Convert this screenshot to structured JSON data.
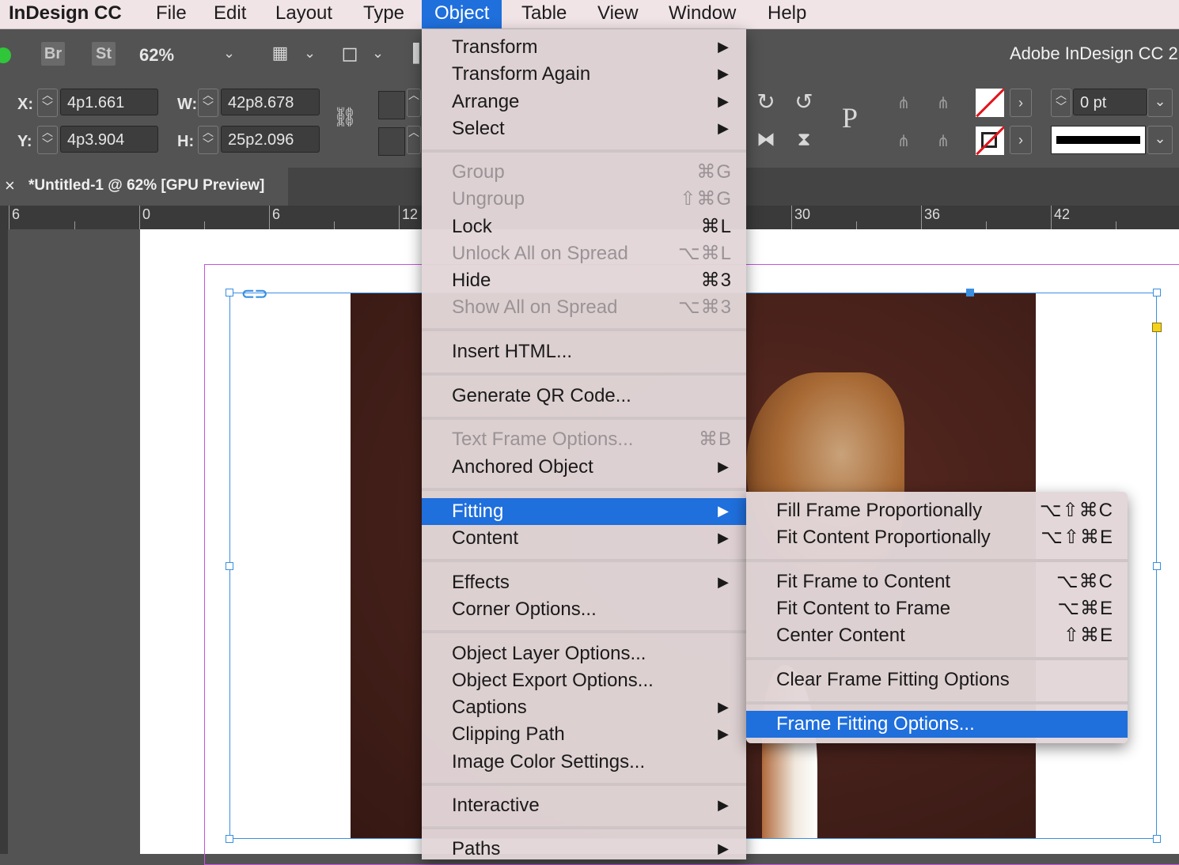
{
  "menubar": {
    "app": "InDesign CC",
    "items": [
      "File",
      "Edit",
      "Layout",
      "Type",
      "Object",
      "Table",
      "View",
      "Window",
      "Help"
    ],
    "active": "Object"
  },
  "control": {
    "bridge": "Br",
    "stock": "St",
    "zoom": "62%",
    "x_label": "X:",
    "x_value": "4p1.661",
    "y_label": "Y:",
    "y_value": "4p3.904",
    "w_label": "W:",
    "w_value": "42p8.678",
    "h_label": "H:",
    "h_value": "25p2.096",
    "stroke_weight": "0 pt",
    "workspace_title": "Adobe InDesign CC 2",
    "icons": [
      "link-constrain-icon",
      "rotate-cw-icon",
      "rotate-ccw-icon",
      "flip-horizontal-icon",
      "flip-vertical-icon",
      "text-frame-icon",
      "align-icon",
      "fill-none-icon",
      "stroke-none-icon",
      "chevron-right-icon",
      "chevron-down-icon"
    ]
  },
  "tab": {
    "close": "×",
    "title": "*Untitled-1 @ 62% [GPU Preview]"
  },
  "ruler": {
    "labels": [
      "6",
      "0",
      "6",
      "12",
      "30",
      "36",
      "42"
    ]
  },
  "object_menu": {
    "items": [
      {
        "label": "Transform",
        "submenu": true
      },
      {
        "label": "Transform Again",
        "submenu": true
      },
      {
        "label": "Arrange",
        "submenu": true
      },
      {
        "label": "Select",
        "submenu": true
      },
      {
        "label": "Group",
        "shortcut": "⌘G",
        "disabled": true
      },
      {
        "label": "Ungroup",
        "shortcut": "⇧⌘G",
        "disabled": true
      },
      {
        "label": "Lock",
        "shortcut": "⌘L"
      },
      {
        "label": "Unlock All on Spread",
        "shortcut": "⌥⌘L",
        "disabled": true
      },
      {
        "label": "Hide",
        "shortcut": "⌘3"
      },
      {
        "label": "Show All on Spread",
        "shortcut": "⌥⌘3",
        "disabled": true
      },
      {
        "label": "Insert HTML..."
      },
      {
        "label": "Generate QR Code..."
      },
      {
        "label": "Text Frame Options...",
        "shortcut": "⌘B",
        "disabled": true
      },
      {
        "label": "Anchored Object",
        "submenu": true
      },
      {
        "label": "Fitting",
        "submenu": true,
        "highlighted": true
      },
      {
        "label": "Content",
        "submenu": true
      },
      {
        "label": "Effects",
        "submenu": true
      },
      {
        "label": "Corner Options..."
      },
      {
        "label": "Object Layer Options..."
      },
      {
        "label": "Object Export Options..."
      },
      {
        "label": "Captions",
        "submenu": true
      },
      {
        "label": "Clipping Path",
        "submenu": true
      },
      {
        "label": "Image Color Settings..."
      },
      {
        "label": "Interactive",
        "submenu": true
      },
      {
        "label": "Paths",
        "submenu": true
      }
    ]
  },
  "fitting_menu": {
    "items": [
      {
        "label": "Fill Frame Proportionally",
        "shortcut": "⌥⇧⌘C"
      },
      {
        "label": "Fit Content Proportionally",
        "shortcut": "⌥⇧⌘E"
      },
      {
        "label": "Fit Frame to Content",
        "shortcut": "⌥⌘C"
      },
      {
        "label": "Fit Content to Frame",
        "shortcut": "⌥⌘E"
      },
      {
        "label": "Center Content",
        "shortcut": "⇧⌘E"
      },
      {
        "label": "Clear Frame Fitting Options"
      },
      {
        "label": "Frame Fitting Options...",
        "highlighted": true
      }
    ]
  },
  "arrow": "▶"
}
